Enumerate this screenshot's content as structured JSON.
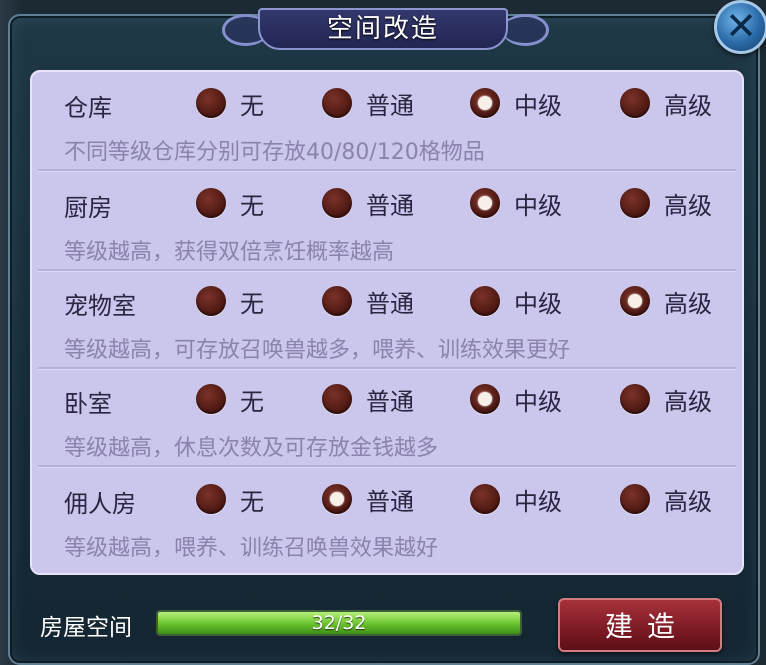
{
  "title": "空间改造",
  "levels": [
    "无",
    "普通",
    "中级",
    "高级"
  ],
  "rooms": [
    {
      "name": "仓库",
      "selected": "中级",
      "description": "不同等级仓库分别可存放40/80/120格物品"
    },
    {
      "name": "厨房",
      "selected": "中级",
      "description": "等级越高，获得双倍烹饪概率越高"
    },
    {
      "name": "宠物室",
      "selected": "高级",
      "description": "等级越高，可存放召唤兽越多，喂养、训练效果更好"
    },
    {
      "name": "卧室",
      "selected": "中级",
      "description": "等级越高，休息次数及可存放金钱越多"
    },
    {
      "name": "佣人房",
      "selected": "普通",
      "description": "等级越高，喂养、训练召唤兽效果越好"
    }
  ],
  "footer": {
    "space_label": "房屋空间",
    "progress_text": "32/32",
    "progress_fraction": 1.0,
    "build_label": "建造"
  },
  "colors": {
    "content_bg": "#cac6ec",
    "radio": "#4a1611",
    "build_button": "#7c1a24",
    "progress_fill": "#6fc632"
  },
  "icons": {
    "close": "close-icon"
  }
}
